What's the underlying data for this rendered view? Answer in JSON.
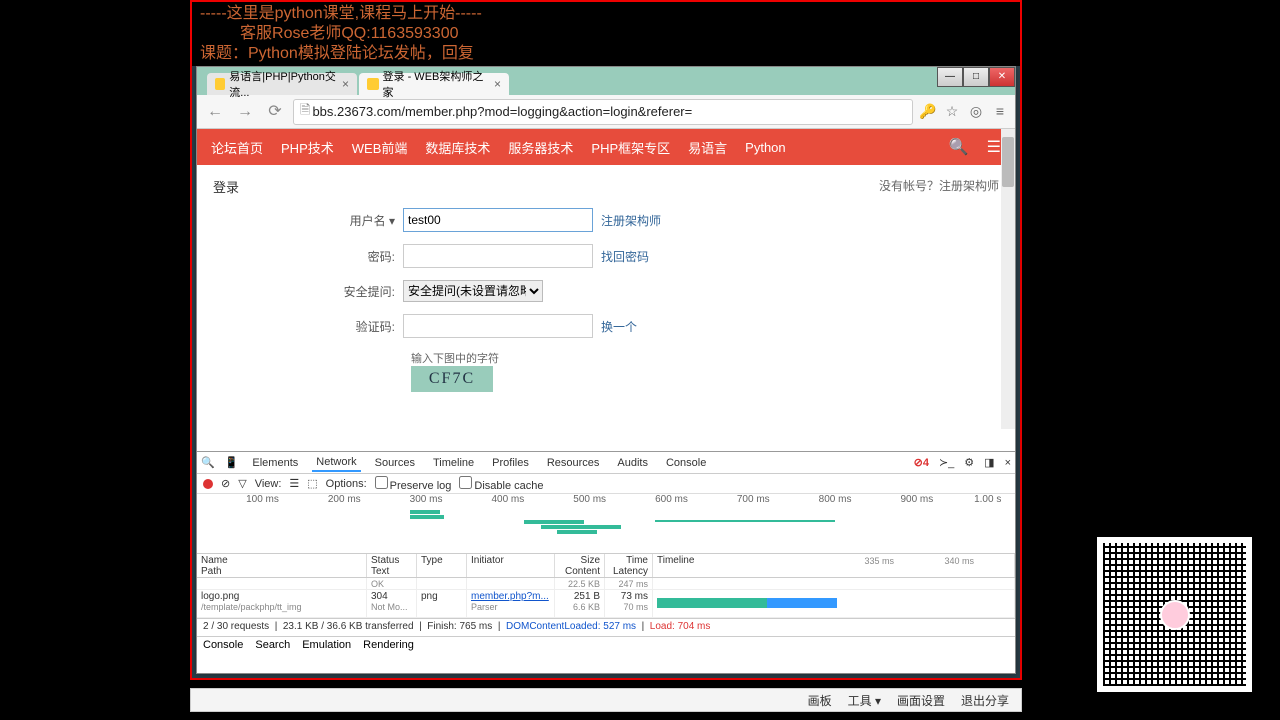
{
  "banner": {
    "line1": "-----这里是python课堂,课程马上开始-----",
    "line2": "         客服Rose老师QQ:1163593300",
    "line3": "课题：Python模拟登陆论坛发帖，回复"
  },
  "tabs": {
    "inactive": "易语言|PHP|Python交流...",
    "active": "登录 - WEB架构师之家"
  },
  "url": "bbs.23673.com/member.php?mod=logging&action=login&referer=",
  "nav_items": [
    "论坛首页",
    "PHP技术",
    "WEB前端",
    "数据库技术",
    "服务器技术",
    "PHP框架专区",
    "易语言",
    "Python"
  ],
  "login": {
    "title": "登录",
    "register_prompt": "没有帐号？注册架构师",
    "username_label": "用户名 ▾",
    "username_value": "test00",
    "username_tip": "注册架构师",
    "password_label": "密码:",
    "password_tip": "找回密码",
    "question_label": "安全提问:",
    "question_option": "安全提问(未设置请忽略)",
    "captcha_label": "验证码:",
    "captcha_tip": "换一个",
    "captcha_hint": "输入下图中的字符",
    "captcha_text": "CF7C"
  },
  "devtools": {
    "tabs": [
      "Elements",
      "Network",
      "Sources",
      "Timeline",
      "Profiles",
      "Resources",
      "Audits",
      "Console"
    ],
    "active_tab": "Network",
    "error_count": "4",
    "view_label": "View:",
    "options_label": "Options:",
    "preserve_log": "Preserve log",
    "disable_cache": "Disable cache",
    "time_ticks": [
      "100 ms",
      "200 ms",
      "300 ms",
      "400 ms",
      "500 ms",
      "600 ms",
      "700 ms",
      "800 ms",
      "900 ms",
      "1.00 s"
    ],
    "columns": {
      "name": "Name",
      "name_sub": "Path",
      "status": "Status",
      "status_sub": "Text",
      "type": "Type",
      "initiator": "Initiator",
      "size": "Size",
      "size_sub": "Content",
      "time": "Time",
      "time_sub": "Latency",
      "timeline": "Timeline",
      "t335": "335 ms",
      "t340": "340 ms"
    },
    "row0": {
      "status": "OK",
      "size": "22.5 KB",
      "time": "247 ms"
    },
    "row": {
      "name": "logo.png",
      "path": "/template/packphp/tt_img",
      "status": "304",
      "status_text": "Not Mo...",
      "type": "png",
      "initiator": "member.php?m...",
      "initiator_sub": "Parser",
      "size": "251 B",
      "content": "6.6 KB",
      "time": "73 ms",
      "latency": "70 ms"
    },
    "summary": {
      "requests": "2 / 30 requests",
      "transferred": "23.1 KB / 36.6 KB transferred",
      "finish": "Finish: 765 ms",
      "dcl": "DOMContentLoaded: 527 ms",
      "load": "Load: 704 ms"
    },
    "bottom_tabs": [
      "Console",
      "Search",
      "Emulation",
      "Rendering"
    ]
  },
  "bottom_bar": [
    "画板",
    "工具 ▾",
    "画面设置",
    "退出分享"
  ]
}
